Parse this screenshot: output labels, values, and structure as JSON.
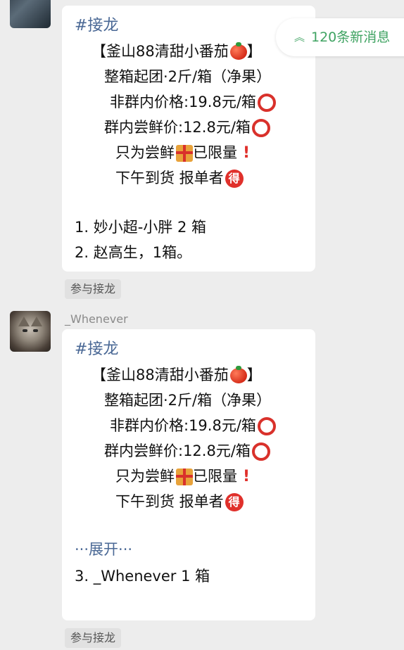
{
  "new_messages": {
    "label": "120条新消息",
    "icon": "double-chevron-up-icon",
    "color": "#3fa362"
  },
  "messages": [
    {
      "hashtag": "#接龙",
      "lines": [
        "【釜山88清甜小番茄",
        "】",
        "整箱起团·2斤/箱（净果）",
        "非群内价格:19.8元/箱",
        "群内尝鲜价:12.8元/箱",
        "只为尝鲜",
        "已限量",
        "下午到货  报单者"
      ],
      "entries": [
        "1. 妙小超-小胖 2 箱",
        "2. 赵高生，1箱。"
      ],
      "action": "参与接龙"
    },
    {
      "sender": "_Whenever",
      "hashtag": "#接龙",
      "lines": [
        "【釜山88清甜小番茄",
        "】",
        "整箱起团·2斤/箱（净果）",
        "非群内价格:19.8元/箱",
        "群内尝鲜价:12.8元/箱",
        "只为尝鲜",
        "已限量",
        "下午到货  报单者"
      ],
      "expand": "···展开···",
      "entries": [
        "3. _Whenever 1 箱"
      ],
      "action": "参与接龙"
    }
  ],
  "emoji_de": "得",
  "emoji_bang": "!",
  "colors": {
    "link": "#4a6895",
    "accent_red": "#e0302b",
    "background": "#ededed"
  }
}
